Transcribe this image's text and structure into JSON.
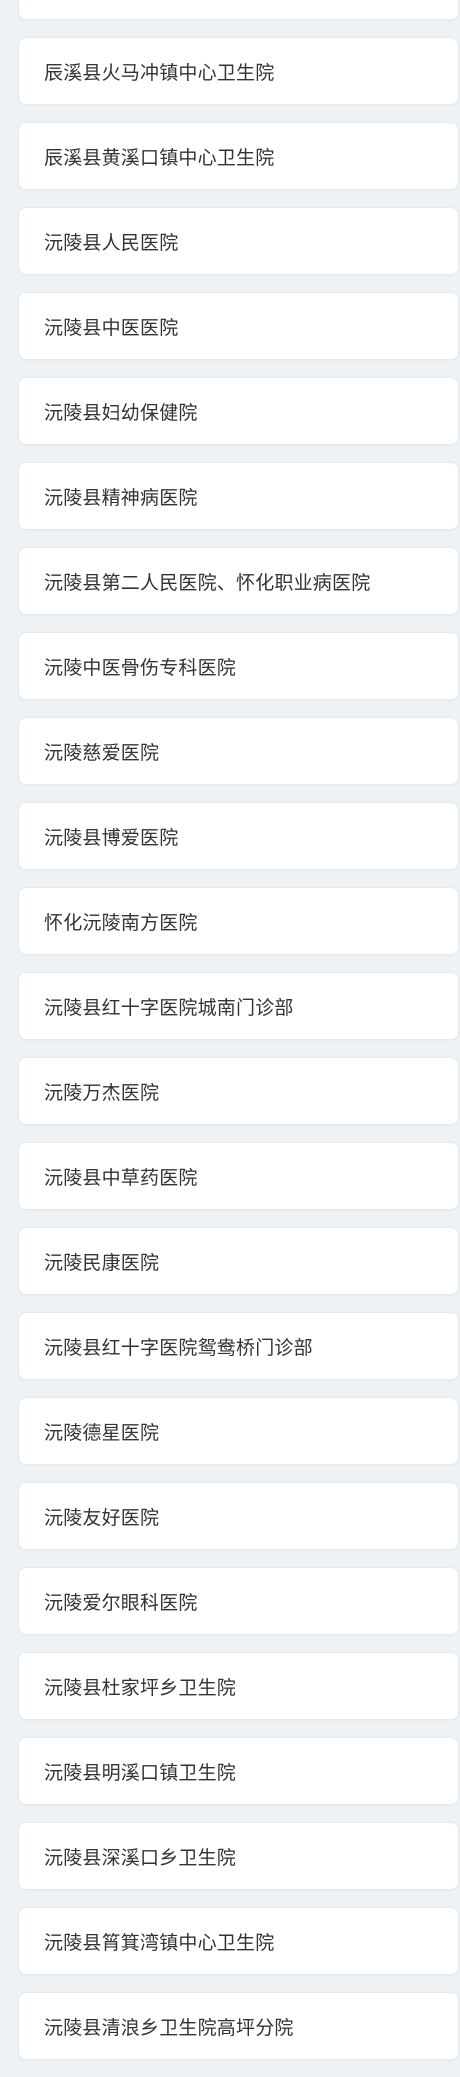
{
  "hospital_list": {
    "items": [
      {
        "label": ""
      },
      {
        "label": "辰溪县火马冲镇中心卫生院"
      },
      {
        "label": "辰溪县黄溪口镇中心卫生院"
      },
      {
        "label": "沅陵县人民医院"
      },
      {
        "label": "沅陵县中医医院"
      },
      {
        "label": "沅陵县妇幼保健院"
      },
      {
        "label": "沅陵县精神病医院"
      },
      {
        "label": "沅陵县第二人民医院、怀化职业病医院"
      },
      {
        "label": "沅陵中医骨伤专科医院"
      },
      {
        "label": "沅陵慈爱医院"
      },
      {
        "label": "沅陵县博爱医院"
      },
      {
        "label": "怀化沅陵南方医院"
      },
      {
        "label": "沅陵县红十字医院城南门诊部"
      },
      {
        "label": "沅陵万杰医院"
      },
      {
        "label": "沅陵县中草药医院"
      },
      {
        "label": "沅陵民康医院"
      },
      {
        "label": "沅陵县红十字医院鸳鸯桥门诊部"
      },
      {
        "label": "沅陵德星医院"
      },
      {
        "label": "沅陵友好医院"
      },
      {
        "label": "沅陵爱尔眼科医院"
      },
      {
        "label": "沅陵县杜家坪乡卫生院"
      },
      {
        "label": "沅陵县明溪口镇卫生院"
      },
      {
        "label": "沅陵县深溪口乡卫生院"
      },
      {
        "label": "沅陵县筲箕湾镇中心卫生院"
      },
      {
        "label": "沅陵县清浪乡卫生院高坪分院"
      }
    ]
  }
}
